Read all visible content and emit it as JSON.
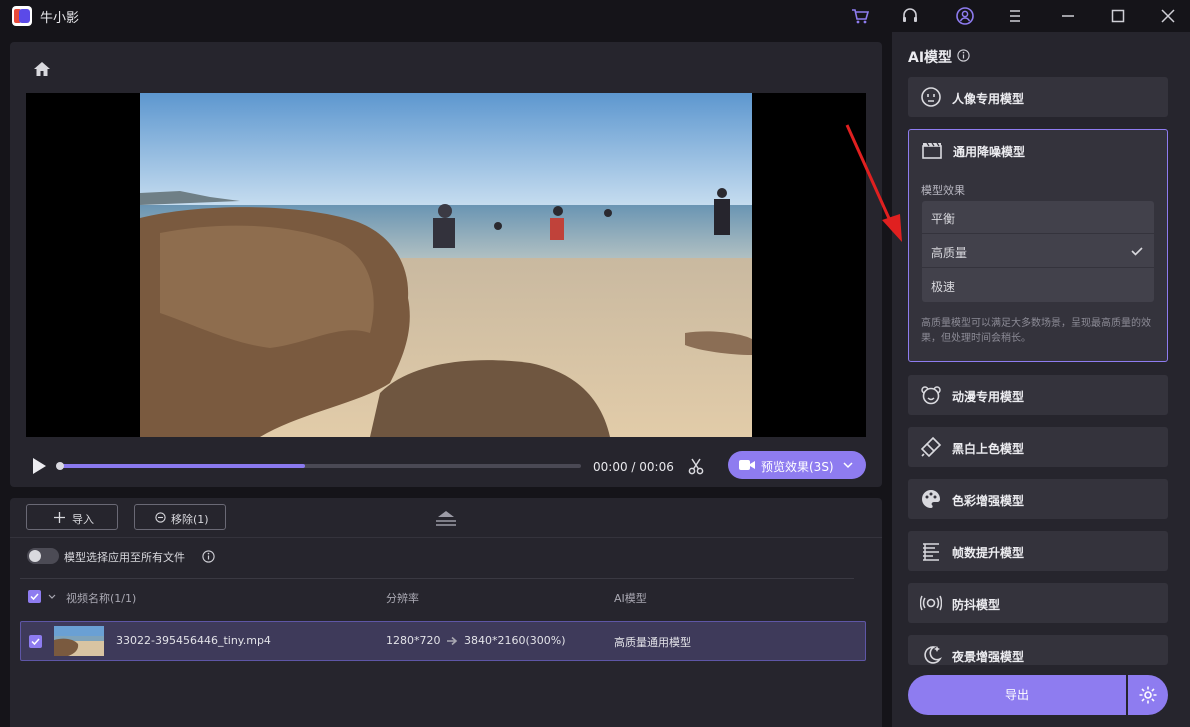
{
  "app": {
    "title": "牛小影"
  },
  "preview": {
    "time": "00:00 / 00:06",
    "progress": 0.47,
    "preview_button": "预览效果(3S)"
  },
  "files": {
    "import_label": "导入",
    "remove_label": "移除(1)",
    "toggle_label": "模型选择应用至所有文件",
    "toggle_on": false,
    "columns": {
      "name": "视频名称(1/1)",
      "resolution": "分辨率",
      "model": "AI模型"
    },
    "rows": [
      {
        "name": "33022-395456446_tiny.mp4",
        "resolution_from": "1280*720",
        "resolution_to": "3840*2160(300%)",
        "model": "高质量通用模型"
      }
    ]
  },
  "ai": {
    "title": "AI模型",
    "models": [
      {
        "name": "人像专用模型",
        "icon": "portrait-icon"
      },
      {
        "name": "通用降噪模型",
        "icon": "clapperboard-icon",
        "active": true
      },
      {
        "name": "动漫专用模型",
        "icon": "bear-icon"
      },
      {
        "name": "黑白上色模型",
        "icon": "brush-icon"
      },
      {
        "name": "色彩增强模型",
        "icon": "palette-icon"
      },
      {
        "name": "帧数提升模型",
        "icon": "frames-icon"
      },
      {
        "name": "防抖模型",
        "icon": "stabilize-icon"
      },
      {
        "name": "夜景增强模型",
        "icon": "night-icon"
      }
    ],
    "effect_label": "模型效果",
    "effects": [
      {
        "label": "平衡",
        "selected": false
      },
      {
        "label": "高质量",
        "selected": true
      },
      {
        "label": "极速",
        "selected": false
      }
    ],
    "description": "高质量模型可以满足大多数场景，呈现最高质量的效果，但处理时间会稍长。",
    "export_label": "导出"
  },
  "colors": {
    "accent": "#8e7cf0",
    "panel": "#26252d",
    "background": "#151419"
  }
}
